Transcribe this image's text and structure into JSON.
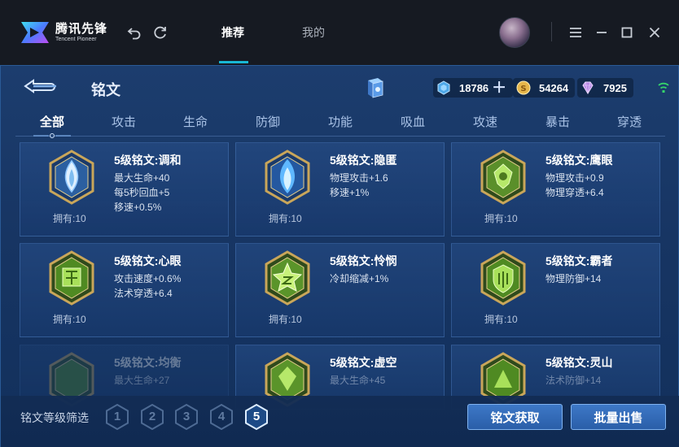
{
  "app": {
    "logo_cn": "腾讯先锋",
    "logo_en": "Tencent Pioneer",
    "nav_tabs": [
      {
        "label": "推荐",
        "active": true
      },
      {
        "label": "我的",
        "active": false
      }
    ]
  },
  "page": {
    "title": "铭文",
    "currencies": [
      {
        "icon": "crystal-icon",
        "value": "18786",
        "color": "#4fa8e8"
      },
      {
        "icon": "gold-coin-icon",
        "value": "54264",
        "color": "#e6b64a"
      },
      {
        "icon": "purple-gem-icon",
        "value": "7925",
        "color": "#b98ae6"
      }
    ]
  },
  "categories": [
    "全部",
    "攻击",
    "生命",
    "防御",
    "功能",
    "吸血",
    "攻速",
    "暴击",
    "穿透"
  ],
  "active_category": "全部",
  "cards": [
    {
      "name": "5级铭文:调和",
      "stats": [
        "最大生命+40",
        "每5秒回血+5",
        "移速+0.5%"
      ],
      "owned": "拥有:10",
      "color": "blue"
    },
    {
      "name": "5级铭文:隐匿",
      "stats": [
        "物理攻击+1.6",
        "移速+1%"
      ],
      "owned": "拥有:10",
      "color": "blue"
    },
    {
      "name": "5级铭文:鹰眼",
      "stats": [
        "物理攻击+0.9",
        "物理穿透+6.4"
      ],
      "owned": "拥有:10",
      "color": "green"
    },
    {
      "name": "5级铭文:心眼",
      "stats": [
        "攻击速度+0.6%",
        "法术穿透+6.4"
      ],
      "owned": "拥有:10",
      "color": "green"
    },
    {
      "name": "5级铭文:怜悯",
      "stats": [
        "冷却缩减+1%"
      ],
      "owned": "拥有:10",
      "color": "green"
    },
    {
      "name": "5级铭文:霸者",
      "stats": [
        "物理防御+14"
      ],
      "owned": "拥有:10",
      "color": "green"
    },
    {
      "name": "5级铭文:均衡",
      "stats": [
        "最大生命+27"
      ],
      "owned": "",
      "color": "green"
    },
    {
      "name": "5级铭文:虚空",
      "stats": [
        "最大生命+45"
      ],
      "owned": "",
      "color": "green"
    },
    {
      "name": "5级铭文:灵山",
      "stats": [
        "法术防御+14"
      ],
      "owned": "",
      "color": "green"
    }
  ],
  "bottom": {
    "filter_label": "铭文等级筛选",
    "levels": [
      "1",
      "2",
      "3",
      "4",
      "5"
    ],
    "active_level": "5",
    "get_button": "铭文获取",
    "sell_button": "批量出售"
  }
}
